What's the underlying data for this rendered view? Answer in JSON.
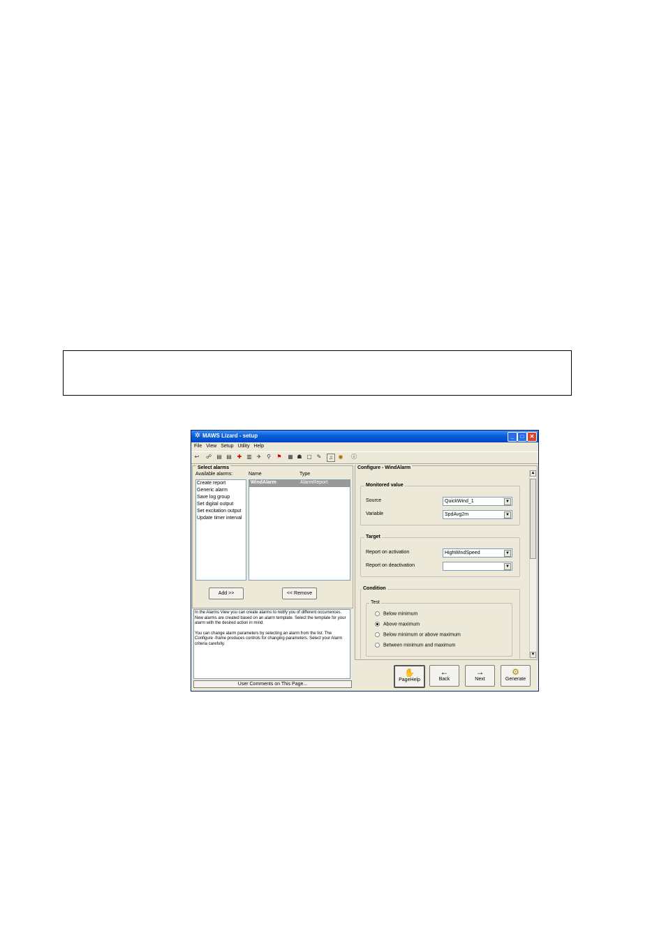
{
  "window": {
    "title": "MAWS Lizard - setup",
    "minimize": "_",
    "maximize": "□",
    "close": "✕"
  },
  "menu": [
    "File",
    "View",
    "Setup",
    "Utility",
    "Help"
  ],
  "toolbar_icons": [
    "undo-icon",
    "network-icon",
    "dev-icon",
    "dev2-icon",
    "split-icon",
    "terminal-icon",
    "wind-icon",
    "sensor-icon",
    "flag-icon",
    "memory-icon",
    "group-icon",
    "doc-icon",
    "hand-icon",
    "bell-icon",
    "globe-icon",
    "info-icon"
  ],
  "left": {
    "select_alarms": "Select alarms",
    "available_label": "Available alarms:",
    "name_col": "Name",
    "type_col": "Type",
    "available": [
      "Create report",
      "Generic alarm",
      "Save log group",
      "Set digital output",
      "Set excitation output",
      "Update timer interval"
    ],
    "alarms": [
      {
        "name": "WindAlarm",
        "type": "AlarmReport"
      }
    ],
    "add": "Add >>",
    "remove": "<< Remove",
    "help_text_1": "In the Alarms View you can create alarms to notify you of different occurrences. New alarms are created based on an alarm template. Select the template for your alarm with the desired action in mind.",
    "help_text_2": "You can change alarm parameters by selecting an alarm from the list. The Configure -frame produces controls for changing parameters. Select your Alarm criteria carefully.",
    "comments": "User Comments on This Page..."
  },
  "right": {
    "configure_title": "Configure - WindAlarm",
    "monitored": {
      "title": "Monitored value",
      "source_label": "Source",
      "source": "QuickWind_1",
      "variable_label": "Variable",
      "variable": "SpdAvg2m"
    },
    "target": {
      "title": "Target",
      "activation_label": "Report on activation",
      "activation": "HighWindSpeed",
      "deactivation_label": "Report on deactivation",
      "deactivation": ""
    },
    "condition": {
      "title": "Condition",
      "test_label": "Test",
      "options": [
        "Below minimum",
        "Above maximum",
        "Below minimum or above maximum",
        "Between minimum and maximum"
      ],
      "selected_index": 1
    }
  },
  "nav": {
    "pagehelp": "PageHelp",
    "back": "Back",
    "next": "Next",
    "generate": "Generate"
  }
}
